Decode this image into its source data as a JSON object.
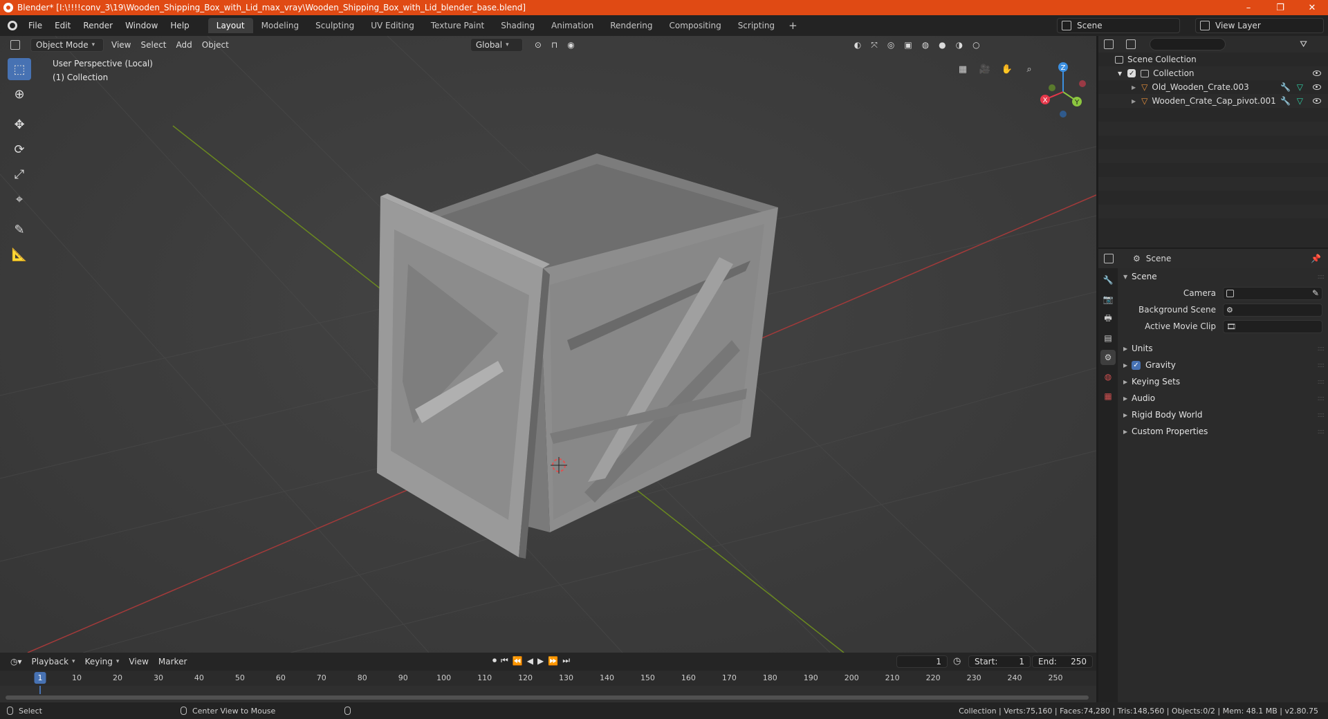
{
  "window": {
    "title": "Blender* [I:\\!!!!conv_3\\19\\Wooden_Shipping_Box_with_Lid_max_vray\\Wooden_Shipping_Box_with_Lid_blender_base.blend]",
    "controls": [
      "–",
      "❐",
      "✕"
    ]
  },
  "menu": {
    "items": [
      "File",
      "Edit",
      "Render",
      "Window",
      "Help"
    ]
  },
  "workspaces": {
    "tabs": [
      "Layout",
      "Modeling",
      "Sculpting",
      "UV Editing",
      "Texture Paint",
      "Shading",
      "Animation",
      "Rendering",
      "Compositing",
      "Scripting"
    ],
    "active": "Layout",
    "add_label": "+"
  },
  "scene_selector": {
    "value": "Scene"
  },
  "view_layer": {
    "value": "View Layer"
  },
  "viewport_header": {
    "mode": "Object Mode",
    "menus": [
      "View",
      "Select",
      "Add",
      "Object"
    ],
    "orientation": "Global"
  },
  "viewport": {
    "perspective": "User Perspective (Local)",
    "collection": "(1) Collection"
  },
  "gizmo": {
    "x": "X",
    "y": "Y",
    "z": "Z"
  },
  "outliner": {
    "root": "Scene Collection",
    "collection": "Collection",
    "objects": [
      "Old_Wooden_Crate.003",
      "Wooden_Crate_Cap_pivot.001"
    ]
  },
  "properties": {
    "context": "Scene",
    "panel_title": "Scene",
    "fields": [
      {
        "label": "Camera",
        "value": ""
      },
      {
        "label": "Background Scene",
        "value": ""
      },
      {
        "label": "Active Movie Clip",
        "value": ""
      }
    ],
    "panels": [
      "Units",
      "Gravity",
      "Keying Sets",
      "Audio",
      "Rigid Body World",
      "Custom Properties"
    ],
    "gravity_checked": true
  },
  "timeline": {
    "menus": [
      "Playback",
      "Keying",
      "View",
      "Marker"
    ],
    "current_frame": "1",
    "start_label": "Start:",
    "start": "1",
    "end_label": "End:",
    "end": "250",
    "ruler": [
      "1",
      "10",
      "20",
      "30",
      "40",
      "50",
      "60",
      "70",
      "80",
      "90",
      "100",
      "110",
      "120",
      "130",
      "140",
      "150",
      "160",
      "170",
      "180",
      "190",
      "200",
      "210",
      "220",
      "230",
      "240",
      "250"
    ]
  },
  "statusbar": {
    "select": "Select",
    "center_view": "Center View to Mouse",
    "stats": "Collection | Verts:75,160 | Faces:74,280 | Tris:148,560 | Objects:0/2 | Mem: 48.1 MB | v2.80.75"
  },
  "colors": {
    "titlebar": "#e04a14",
    "accent": "#4772b3",
    "axis_x": "#e6374a",
    "axis_y": "#8cc63f",
    "axis_z": "#3b8fe0"
  }
}
